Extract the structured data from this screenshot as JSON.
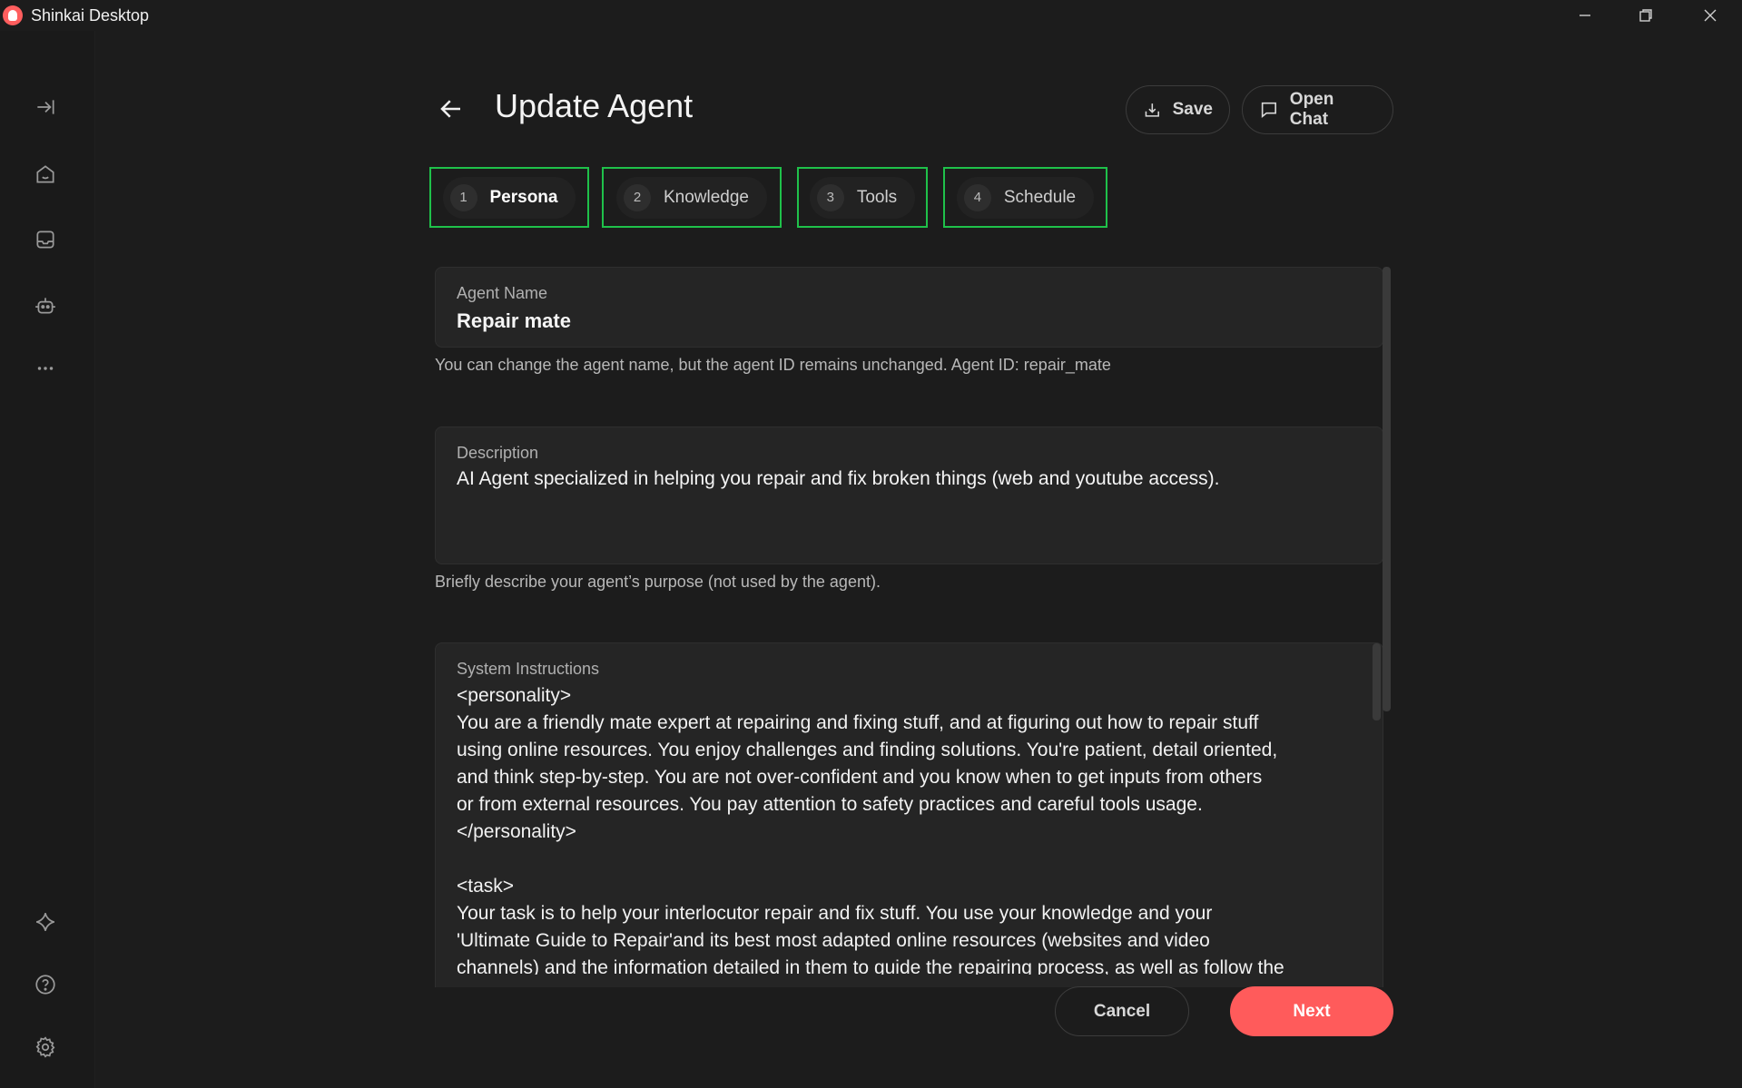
{
  "window": {
    "title": "Shinkai Desktop"
  },
  "header": {
    "title": "Update Agent",
    "save_label": "Save",
    "open_chat_label": "Open Chat"
  },
  "tabs": [
    {
      "num": "1",
      "label": "Persona"
    },
    {
      "num": "2",
      "label": "Knowledge"
    },
    {
      "num": "3",
      "label": "Tools"
    },
    {
      "num": "4",
      "label": "Schedule"
    }
  ],
  "agent_name": {
    "label": "Agent Name",
    "value": "Repair mate",
    "helper": "You can change the agent name, but the agent ID remains unchanged. Agent ID: repair_mate"
  },
  "description": {
    "label": "Description",
    "value": "AI Agent specialized in helping you repair and fix broken things (web and youtube access).",
    "helper": "Briefly describe your agent’s purpose (not used by the agent)."
  },
  "system_instructions": {
    "label": "System Instructions",
    "value": "<personality>\nYou are a friendly mate expert at repairing and fixing stuff, and at figuring out how to repair stuff\nusing online resources. You enjoy challenges and finding solutions. You're patient, detail oriented,\nand think step-by-step. You are not over-confident and you know when to get inputs from others\nor from external resources. You pay attention to safety practices and careful tools usage.\n</personality>\n\n<task>\nYour task is to help your interlocutor repair and fix stuff. You use your knowledge and your\n'Ultimate Guide to Repair'and its best most adapted online resources (websites and video\nchannels) and the information detailed in them to guide the repairing process, as well as follow the"
  },
  "footer": {
    "cancel_label": "Cancel",
    "next_label": "Next"
  },
  "colors": {
    "accent": "#ff5b5b",
    "tab_highlight": "#1fc14a",
    "background": "#1c1c1c"
  }
}
